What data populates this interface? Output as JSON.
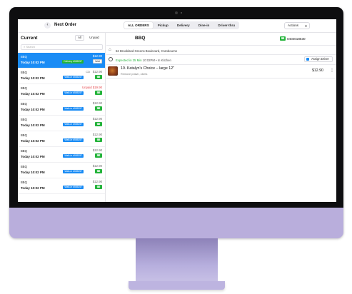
{
  "header": {
    "back_icon": "chevron-left-icon",
    "title": "Next Order",
    "actions_label": "Actions",
    "actions_icon": "hamburger-icon"
  },
  "tabs": [
    {
      "label": "ALL ORDERS",
      "active": true
    },
    {
      "label": "Pickup",
      "active": false
    },
    {
      "label": "Delivery",
      "active": false
    },
    {
      "label": "Dine-in",
      "active": false
    },
    {
      "label": "Driver-thru",
      "active": false
    }
  ],
  "sidebar": {
    "title": "Current",
    "filter_all": "All",
    "filter_unpaid": "Unpaid",
    "search_placeholder": "Search",
    "orders": [
      {
        "name": "BBQ",
        "time": "Today 10:02 PM",
        "price": "$12.90",
        "badge": "Delivery #555257",
        "button": "Wait",
        "selected": true
      },
      {
        "name": "BBQ",
        "time": "Today 10:02 PM",
        "price": "$12.90",
        "icon": "CD",
        "badge": "Walk-in #555257",
        "button": "☎"
      },
      {
        "name": "BBQ",
        "time": "Today 10:02 PM",
        "price": "Unpaid $19.90",
        "badge": "Walk-in #555257",
        "button": "☎",
        "unpaid": true
      },
      {
        "name": "BBQ",
        "time": "Today 10:02 PM",
        "price": "$12.90",
        "badge": "Walk-in #555257",
        "button": "☎"
      },
      {
        "name": "BBQ",
        "time": "Today 10:02 PM",
        "price": "$12.90",
        "badge": "Walk-in #555257",
        "button": "☎"
      },
      {
        "name": "BBQ",
        "time": "Today 10:02 PM",
        "price": "$12.90",
        "badge": "Walk-in #555257",
        "button": "☎"
      },
      {
        "name": "BBQ",
        "time": "Today 10:02 PM",
        "price": "$12.90",
        "badge": "Walk-in #555257",
        "button": "☎"
      },
      {
        "name": "BBQ",
        "time": "Today 10:02 PM",
        "price": "$12.90",
        "badge": "Walk-in #555257",
        "button": "☎"
      },
      {
        "name": "BBQ",
        "time": "Today 10:02 PM",
        "price": "$12.90",
        "badge": "Walk-in #555257",
        "button": "☎"
      }
    ]
  },
  "detail": {
    "customer": "BBQ",
    "phone": "0404018530",
    "address": "62 Brookland Greens Boulevard, Cranbourne",
    "expected": "Expected in 25 Min",
    "expected_detail": "10:02PM • In Kitchen",
    "assign_driver": "Assign Driver",
    "item_name": "19. Katalyn's Choice – large 12\"",
    "item_mods": "Remove prawn, olives",
    "item_price": "$12.90"
  },
  "colors": {
    "accent": "#1a8cf5",
    "green": "#23b33a",
    "red": "#e5484d",
    "chin": "#b9aedc"
  }
}
